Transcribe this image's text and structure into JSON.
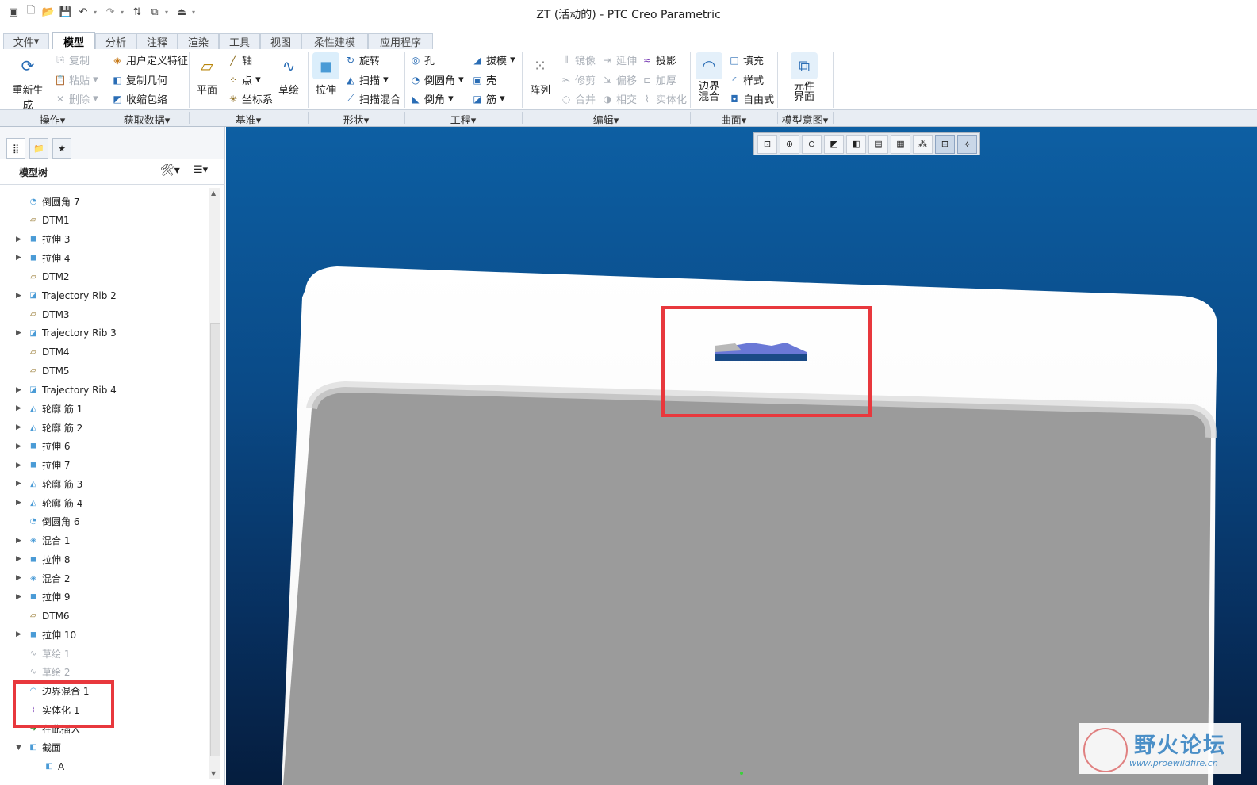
{
  "window": {
    "title": "ZT (活动的) - PTC Creo Parametric"
  },
  "quick_access": [
    "window-icon",
    "new-icon",
    "open-icon",
    "save-icon",
    "undo-icon",
    "redo-icon",
    "regenerate-icon",
    "windows-icon",
    "close-icon",
    "customize-icon"
  ],
  "tabs": [
    "文件",
    "模型",
    "分析",
    "注释",
    "渲染",
    "工具",
    "视图",
    "柔性建模",
    "应用程序"
  ],
  "active_tab": "模型",
  "ribbon": {
    "regen": "重新生成",
    "copy": "复制",
    "paste": "粘贴",
    "delete": "删除",
    "udf": "用户定义特征",
    "copy_geom": "复制几何",
    "shrinkwrap": "收缩包络",
    "plane": "平面",
    "axis": "轴",
    "point": "点",
    "csys": "坐标系",
    "sketch": "草绘",
    "extrude": "拉伸",
    "revolve": "旋转",
    "sweep": "扫描",
    "swept_blend": "扫描混合",
    "hole": "孔",
    "round": "倒圆角",
    "chamfer": "倒角",
    "draft": "拔模",
    "shell": "壳",
    "rib": "筋",
    "pattern": "阵列",
    "mirror": "镜像",
    "trim": "修剪",
    "merge": "合并",
    "extend": "延伸",
    "offset": "偏移",
    "intersect": "相交",
    "project": "投影",
    "thicken": "加厚",
    "solidify": "实体化",
    "boundary_blend": "边界混合",
    "fill": "填充",
    "style": "样式",
    "freestyle": "自由式",
    "component_interface": "元件界面"
  },
  "groups": [
    "操作",
    "获取数据",
    "基准",
    "形状",
    "工程",
    "编辑",
    "曲面",
    "模型意图"
  ],
  "tree": {
    "header": "模型树",
    "items": [
      {
        "label": "倒圆角 7",
        "expandable": false,
        "icon": "round-icon",
        "disabled": false
      },
      {
        "label": "DTM1",
        "expandable": false,
        "icon": "datum-plane-icon",
        "disabled": false
      },
      {
        "label": "拉伸 3",
        "expandable": true,
        "icon": "extrude-icon",
        "disabled": false
      },
      {
        "label": "拉伸 4",
        "expandable": true,
        "icon": "extrude-icon",
        "disabled": false
      },
      {
        "label": "DTM2",
        "expandable": false,
        "icon": "datum-plane-icon",
        "disabled": false
      },
      {
        "label": "Trajectory Rib 2",
        "expandable": true,
        "icon": "rib-icon",
        "disabled": false
      },
      {
        "label": "DTM3",
        "expandable": false,
        "icon": "datum-plane-icon",
        "disabled": false
      },
      {
        "label": "Trajectory Rib 3",
        "expandable": true,
        "icon": "rib-icon",
        "disabled": false
      },
      {
        "label": "DTM4",
        "expandable": false,
        "icon": "datum-plane-icon",
        "disabled": false
      },
      {
        "label": "DTM5",
        "expandable": false,
        "icon": "datum-plane-icon",
        "disabled": false
      },
      {
        "label": "Trajectory Rib 4",
        "expandable": true,
        "icon": "rib-icon",
        "disabled": false
      },
      {
        "label": "轮廓 筋 1",
        "expandable": true,
        "icon": "profile-rib-icon",
        "disabled": false
      },
      {
        "label": "轮廓 筋 2",
        "expandable": true,
        "icon": "profile-rib-icon",
        "disabled": false
      },
      {
        "label": "拉伸 6",
        "expandable": true,
        "icon": "extrude-icon",
        "disabled": false
      },
      {
        "label": "拉伸 7",
        "expandable": true,
        "icon": "extrude-icon",
        "disabled": false
      },
      {
        "label": "轮廓 筋 3",
        "expandable": true,
        "icon": "profile-rib-icon",
        "disabled": false
      },
      {
        "label": "轮廓 筋 4",
        "expandable": true,
        "icon": "profile-rib-icon",
        "disabled": false
      },
      {
        "label": "倒圆角 6",
        "expandable": false,
        "icon": "round-icon",
        "disabled": false
      },
      {
        "label": "混合 1",
        "expandable": true,
        "icon": "blend-icon",
        "disabled": false
      },
      {
        "label": "拉伸 8",
        "expandable": true,
        "icon": "extrude-icon",
        "disabled": false
      },
      {
        "label": "混合 2",
        "expandable": true,
        "icon": "blend-icon",
        "disabled": false
      },
      {
        "label": "拉伸 9",
        "expandable": true,
        "icon": "extrude-icon",
        "disabled": false
      },
      {
        "label": "DTM6",
        "expandable": false,
        "icon": "datum-plane-icon",
        "disabled": false
      },
      {
        "label": "拉伸 10",
        "expandable": true,
        "icon": "extrude-icon",
        "disabled": false
      },
      {
        "label": "草绘 1",
        "expandable": false,
        "icon": "sketch-icon",
        "disabled": true
      },
      {
        "label": "草绘 2",
        "expandable": false,
        "icon": "sketch-icon",
        "disabled": true
      },
      {
        "label": "边界混合 1",
        "expandable": false,
        "icon": "boundary-blend-icon",
        "disabled": false
      },
      {
        "label": "实体化 1",
        "expandable": false,
        "icon": "solidify-icon",
        "disabled": false
      },
      {
        "label": "在此插入",
        "expandable": false,
        "icon": "insert-here-icon",
        "disabled": false
      },
      {
        "label": "截面",
        "expandable": true,
        "expanded": true,
        "icon": "section-icon",
        "disabled": false
      },
      {
        "label": "A",
        "expandable": false,
        "icon": "section-icon",
        "disabled": false,
        "indent": true
      }
    ]
  },
  "view_toolbar": [
    "refit-icon",
    "zoom-in-icon",
    "zoom-out-icon",
    "repaint-icon",
    "display-style-icon",
    "saved-orientations-icon",
    "view-manager-icon",
    "perspective-icon",
    "datum-display-icon",
    "annotation-display-icon"
  ],
  "watermark": {
    "text": "野火论坛",
    "url": "www.proewildfire.cn"
  },
  "colors": {
    "accent": "#0a4a87",
    "highlight": "#e8383d",
    "part": "#ffffff",
    "part_shaded": "#9b9b9b"
  }
}
